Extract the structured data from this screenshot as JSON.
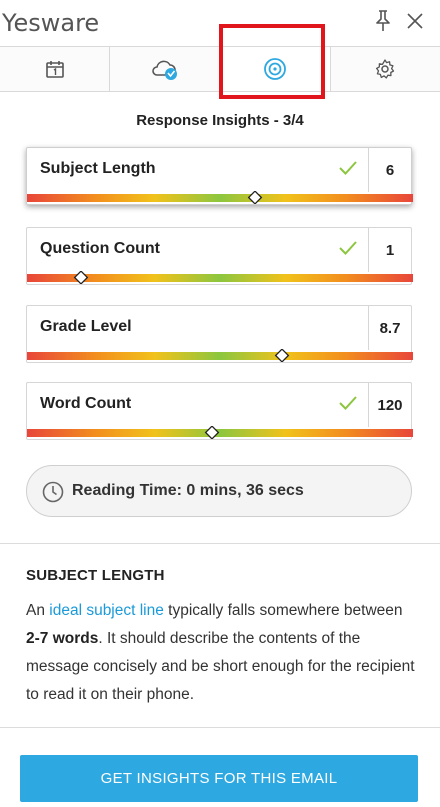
{
  "app": {
    "title": "Yesware"
  },
  "tabs": [
    {
      "icon": "calendar-icon",
      "active": false
    },
    {
      "icon": "cloud-sync-icon",
      "active": false
    },
    {
      "icon": "target-icon",
      "active": true
    },
    {
      "icon": "gear-icon",
      "active": false
    }
  ],
  "insights": {
    "title": "Response Insights - 3/4",
    "metrics": [
      {
        "label": "Subject Length",
        "value": "6",
        "checked": true,
        "marker_fraction": 0.59,
        "selected": true
      },
      {
        "label": "Question Count",
        "value": "1",
        "checked": true,
        "marker_fraction": 0.14,
        "selected": false
      },
      {
        "label": "Grade Level",
        "value": "8.7",
        "checked": false,
        "marker_fraction": 0.66,
        "selected": false
      },
      {
        "label": "Word Count",
        "value": "120",
        "checked": true,
        "marker_fraction": 0.48,
        "selected": false
      }
    ],
    "reading_time": "Reading Time: 0 mins, 36 secs"
  },
  "detail": {
    "heading": "SUBJECT LENGTH",
    "intro": "An ",
    "link": "ideal subject line",
    "text1": " typically falls somewhere between ",
    "bold": "2-7 words",
    "text2": ". It should describe the contents of the message concisely and be short enough for the recipient to read it on their phone."
  },
  "cta": {
    "label": "GET INSIGHTS FOR THIS EMAIL"
  },
  "colors": {
    "accent": "#2ea8e0",
    "check": "#8cc63f",
    "highlight": "#e0161c"
  }
}
